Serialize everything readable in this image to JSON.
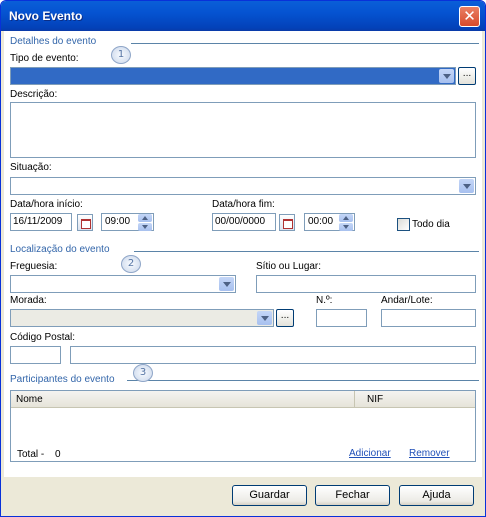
{
  "window": {
    "title": "Novo Evento",
    "close_glyph": "✕"
  },
  "sections": {
    "details": {
      "label": "Detalhes do evento",
      "badge": "1"
    },
    "location": {
      "label": "Localização do evento",
      "badge": "2"
    },
    "participants": {
      "label": "Participantes do evento",
      "badge": "3"
    }
  },
  "details": {
    "event_type_label": "Tipo de evento:",
    "event_type_value": "",
    "browse_glyph": "...",
    "description_label": "Descrição:",
    "description_value": "",
    "status_label": "Situação:",
    "status_value": "",
    "start_label": "Data/hora início:",
    "start_date": "16/11/2009",
    "start_time": "09:00",
    "end_label": "Data/hora fim:",
    "end_date": "00/00/0000",
    "end_time": "00:00",
    "all_day_label": "Todo dia",
    "all_day_checked": false
  },
  "location": {
    "parish_label": "Freguesia:",
    "parish_value": "",
    "site_label": "Sítio ou Lugar:",
    "site_value": "",
    "address_label": "Morada:",
    "address_value": "",
    "browse_glyph": "...",
    "number_label": "N.º:",
    "number_value": "",
    "floor_label": "Andar/Lote:",
    "floor_value": "",
    "postal_label": "Código Postal:",
    "postal_code": "",
    "postal_locality": ""
  },
  "participants": {
    "columns": [
      "Nome",
      "NIF"
    ],
    "rows": [],
    "total_label": "Total -",
    "total_value": "0",
    "add_link": "Adicionar",
    "remove_link": "Remover"
  },
  "footer": {
    "save_label": "Guardar",
    "close_label": "Fechar",
    "help_label": "Ajuda"
  },
  "colors": {
    "titlebar": "#0553d1",
    "section_label": "#3366aa",
    "link": "#2050b8",
    "selected_combo": "#316ac5"
  }
}
